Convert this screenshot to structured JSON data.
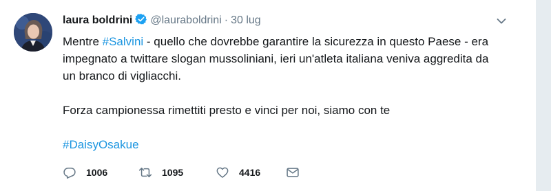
{
  "tweet": {
    "author_name": "laura boldrini",
    "handle": "@lauraboldrini",
    "separator": "·",
    "date": "30 lug",
    "text_part1": "Mentre ",
    "hashtag1": "#Salvini",
    "text_part2": " - quello che dovrebbe garantire la sicurezza in questo Paese - era impegnato a twittare slogan mussoliniani, ieri un'atleta italiana veniva aggredita da un branco di vigliacchi.",
    "paragraph2": "Forza campionessa rimettiti presto e vinci per noi, siamo con te",
    "hashtag2": "#DaisyOsakue"
  },
  "actions": {
    "replies": "1006",
    "retweets": "1095",
    "likes": "4416"
  },
  "colors": {
    "link": "#1b95e0",
    "verified": "#1da1f2",
    "muted": "#657786",
    "text": "#14171a"
  },
  "icons": [
    "avatar",
    "verified-icon",
    "chevron-down-icon",
    "reply-icon",
    "retweet-icon",
    "like-icon",
    "message-icon"
  ]
}
